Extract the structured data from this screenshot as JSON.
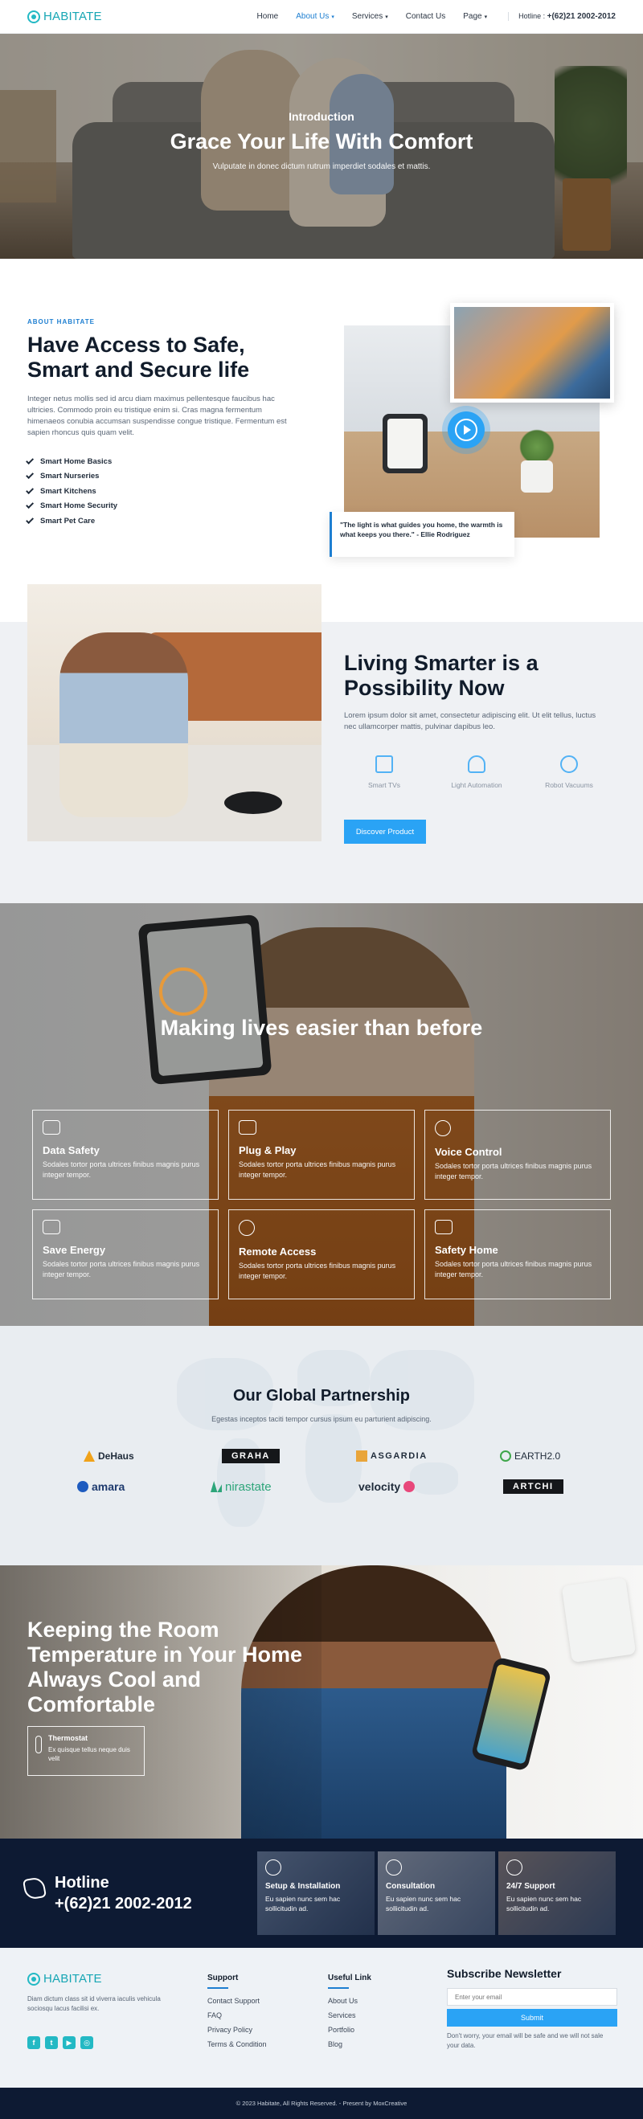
{
  "nav": {
    "brand": "HABITATE",
    "links": [
      {
        "label": "Home",
        "caret": false
      },
      {
        "label": "About Us",
        "caret": true
      },
      {
        "label": "Services",
        "caret": true
      },
      {
        "label": "Contact Us",
        "caret": false
      },
      {
        "label": "Page",
        "caret": true
      }
    ],
    "active_link": "About Us",
    "hotline_label": "Hotline :",
    "hotline_number": "+(62)21 2002-2012"
  },
  "hero": {
    "kicker": "Introduction",
    "title": "Grace Your Life With Comfort",
    "subtitle": "Vulputate in donec dictum rutrum imperdiet sodales et mattis."
  },
  "about": {
    "kicker": "ABOUT HABITATE",
    "title": "Have Access to Safe, Smart and Secure life",
    "body": "Integer netus mollis sed id arcu diam maximus pellentesque faucibus hac ultricies. Commodo proin eu tristique enim si. Cras magna fermentum himenaeos conubia accumsan suspendisse congue tristique. Fermentum est sapien rhoncus quis quam velit.",
    "checklist": [
      "Smart Home Basics",
      "Smart Nurseries",
      "Smart Kitchens",
      "Smart Home Security",
      "Smart Pet Care"
    ],
    "quote": "\"The light is what guides you home, the warmth is what keeps you there.\" - Ellie Rodriguez"
  },
  "living": {
    "title": "Living Smarter is a Possibility Now",
    "body": "Lorem ipsum dolor sit amet, consectetur adipiscing elit. Ut elit tellus, luctus nec ullamcorper mattis, pulvinar dapibus leo.",
    "features": [
      {
        "label": "Smart TVs",
        "icon": "tv-icon"
      },
      {
        "label": "Light Automation",
        "icon": "lightbulb-icon"
      },
      {
        "label": "Robot Vacuums",
        "icon": "robot-icon"
      }
    ],
    "button": "Discover Product"
  },
  "easier": {
    "title": "Making lives easier than before",
    "cards": [
      {
        "title": "Data Safety",
        "text": "Sodales tortor porta ultrices finibus magnis purus integer tempor.",
        "icon": "database-icon"
      },
      {
        "title": "Plug & Play",
        "text": "Sodales tortor porta ultrices finibus magnis purus integer tempor.",
        "icon": "plug-icon"
      },
      {
        "title": "Voice Control",
        "text": "Sodales tortor porta ultrices finibus magnis purus integer tempor.",
        "icon": "microphone-icon"
      },
      {
        "title": "Save Energy",
        "text": "Sodales tortor porta ultrices finibus magnis purus integer tempor.",
        "icon": "battery-icon"
      },
      {
        "title": "Remote Access",
        "text": "Sodales tortor porta ultrices finibus magnis purus integer tempor.",
        "icon": "remote-icon"
      },
      {
        "title": "Safety Home",
        "text": "Sodales tortor porta ultrices finibus magnis purus integer tempor.",
        "icon": "home-shield-icon"
      }
    ]
  },
  "partnership": {
    "title": "Our Global Partnership",
    "subtitle": "Egestas inceptos taciti tempor cursus ipsum eu parturient adipiscing.",
    "logos": [
      "DeHaus",
      "GRAHA",
      "ASGARDIA",
      "EARTH2.0",
      "amara",
      "nirastate",
      "velocity",
      "ARTCHI"
    ]
  },
  "room": {
    "title": "Keeping the Room Temperature in Your Home Always Cool and Comfortable",
    "box_title": "Thermostat",
    "box_text": "Ex quisque tellus neque duis velit"
  },
  "hotline": {
    "label": "Hotline",
    "number": "+(62)21 2002-2012",
    "services": [
      {
        "title": "Setup & Installation",
        "text": "Eu sapien nunc sem hac sollicitudin ad."
      },
      {
        "title": "Consultation",
        "text": "Eu sapien nunc sem hac sollicitudin ad."
      },
      {
        "title": "24/7 Support",
        "text": "Eu sapien nunc sem hac sollicitudin ad."
      }
    ]
  },
  "footer": {
    "brand": "HABITATE",
    "description": "Diam dictum class sit id viverra iaculis vehicula sociosqu lacus facilisi ex.",
    "support_heading": "Support",
    "support_links": [
      "Contact Support",
      "FAQ",
      "Privacy Policy",
      "Terms & Condition"
    ],
    "useful_heading": "Useful Link",
    "useful_links": [
      "About Us",
      "Services",
      "Portfolio",
      "Blog"
    ],
    "newsletter_heading": "Subscribe Newsletter",
    "email_placeholder": "Enter your email",
    "submit_label": "Submit",
    "newsletter_note": "Don't worry, your email will be safe and we will not sale your data.",
    "copyright": "© 2023 Habitate, All Rights Reserved. - Present by MoxCreative"
  },
  "colors": {
    "accent": "#2aa3f5",
    "brand": "#23b9c4",
    "navy": "#0d1a33"
  }
}
